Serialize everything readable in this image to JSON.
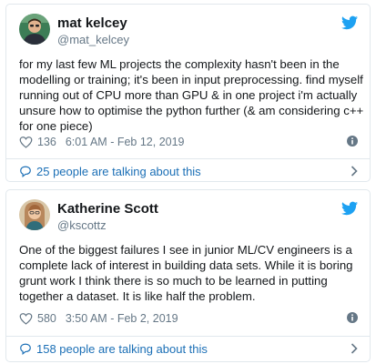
{
  "tweets": [
    {
      "display_name": "mat kelcey",
      "handle": "@mat_kelcey",
      "text": "for my last few ML projects the complexity hasn't been in the modelling or training; it's been in input preprocessing. find myself running out of CPU more than GPU & in one project i'm actually unsure how to optimise the python further (& am considering c++ for one piece)",
      "likes": "136",
      "timestamp": "6:01 AM - Feb 12, 2019",
      "talking": "25 people are talking about this",
      "avatar_icon": "profile-photo-man",
      "colors": {
        "avatar_bg": "#3c7d56"
      }
    },
    {
      "display_name": "Katherine Scott",
      "handle": "@kscottz",
      "text": "One of the biggest failures I see in junior ML/CV engineers is a complete lack of interest in building data sets. While it is boring grunt work I think there is so much to be learned in putting together a dataset. It is like half the problem.",
      "likes": "580",
      "timestamp": "3:50 AM - Feb 2, 2019",
      "talking": "158 people are talking about this",
      "avatar_icon": "profile-photo-woman",
      "colors": {
        "avatar_bg": "#b8875c"
      }
    }
  ],
  "icons": {
    "brand": "twitter-bird-icon",
    "like": "heart-icon",
    "info": "info-icon",
    "reply": "speech-bubble-icon",
    "more": "chevron-right-icon"
  },
  "colors": {
    "twitter_blue": "#1da1f2",
    "link": "#1b6fb6",
    "secondary_text": "#657786",
    "border": "#e1e8ed"
  }
}
